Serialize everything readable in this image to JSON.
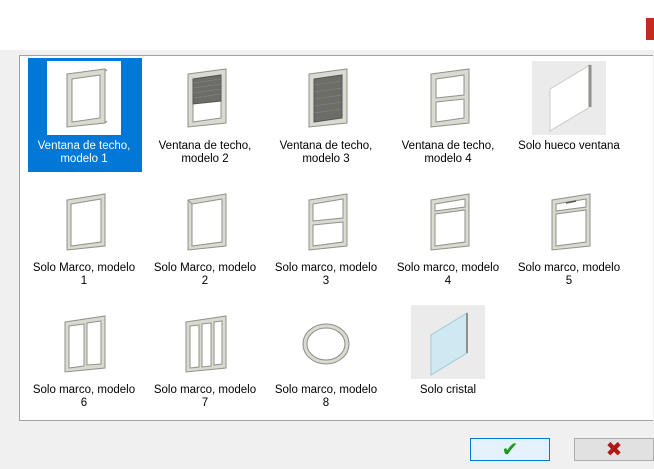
{
  "dialog": {
    "items": [
      {
        "label": "Ventana de techo,\nmodelo 1",
        "icon": "skylight-model-1-icon"
      },
      {
        "label": "Ventana de techo,\nmodelo 2",
        "icon": "skylight-model-2-icon"
      },
      {
        "label": "Ventana de techo,\nmodelo 3",
        "icon": "skylight-model-3-icon"
      },
      {
        "label": "Ventana de techo,\nmodelo 4",
        "icon": "skylight-model-4-icon"
      },
      {
        "label": "Solo hueco ventana",
        "icon": "window-opening-icon"
      },
      {
        "label": "Solo Marco, modelo\n1",
        "icon": "frame-model-1-icon"
      },
      {
        "label": "Solo Marco, modelo\n2",
        "icon": "frame-model-2-icon"
      },
      {
        "label": "Solo marco, modelo\n3",
        "icon": "frame-model-3-icon"
      },
      {
        "label": "Solo marco, modelo\n4",
        "icon": "frame-model-4-icon"
      },
      {
        "label": "Solo marco, modelo\n5",
        "icon": "frame-model-5-icon"
      },
      {
        "label": "Solo marco, modelo\n6",
        "icon": "frame-model-6-icon"
      },
      {
        "label": "Solo marco, modelo\n7",
        "icon": "frame-model-7-icon"
      },
      {
        "label": "Solo marco, modelo\n8",
        "icon": "frame-model-8-icon"
      },
      {
        "label": "Solo cristal",
        "icon": "glass-pane-icon"
      }
    ],
    "selected_index": 0,
    "ok_icon": "checkmark-icon",
    "cancel_icon": "cross-icon"
  },
  "colors": {
    "selection": "#0078d7",
    "ok_green": "#1e9a1e",
    "cancel_red": "#b01818",
    "close_red": "#c42b1c"
  }
}
